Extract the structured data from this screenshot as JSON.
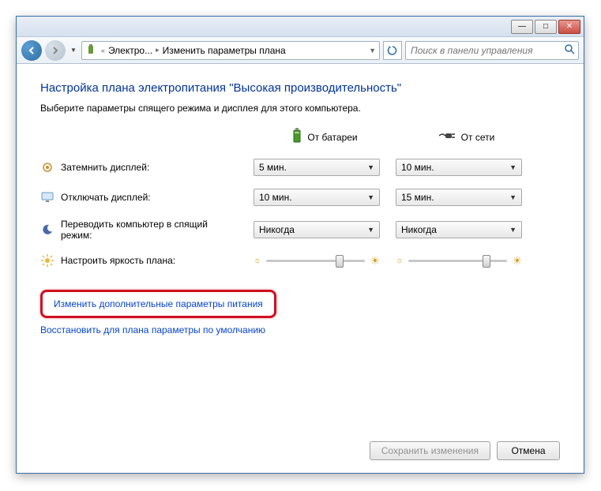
{
  "titlebar": {
    "minimize": "—",
    "maximize": "□",
    "close": "✕"
  },
  "nav": {
    "crumb1": "Электро...",
    "crumb2": "Изменить параметры плана",
    "search_placeholder": "Поиск в панели управления"
  },
  "page": {
    "title": "Настройка плана электропитания \"Высокая производительность\"",
    "subtitle": "Выберите параметры спящего режима и дисплея для этого компьютера."
  },
  "columns": {
    "battery": "От батареи",
    "plugged": "От сети"
  },
  "rows": {
    "dim": {
      "label": "Затемнить дисплей:",
      "battery": "5 мин.",
      "plugged": "10 мин."
    },
    "off": {
      "label": "Отключать дисплей:",
      "battery": "10 мин.",
      "plugged": "15 мин."
    },
    "sleep": {
      "label": "Переводить компьютер в спящий режим:",
      "battery": "Никогда",
      "plugged": "Никогда"
    },
    "bright": {
      "label": "Настроить яркость плана:"
    }
  },
  "links": {
    "advanced": "Изменить дополнительные параметры питания",
    "restore": "Восстановить для плана параметры по умолчанию"
  },
  "buttons": {
    "save": "Сохранить изменения",
    "cancel": "Отмена"
  }
}
